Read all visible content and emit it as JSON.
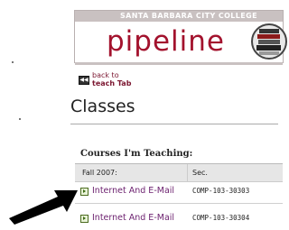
{
  "header": {
    "college": "SANTA BARBARA CITY COLLEGE",
    "brand": "pipeline",
    "colors": {
      "brand": "#a3122d",
      "banner_gray": "#c9c1c1",
      "link": "#6b1f6e"
    }
  },
  "back_link": {
    "line1": "back to",
    "line2": "teach Tab"
  },
  "page_title": "Classes",
  "section_title": "Courses I'm Teaching:",
  "table": {
    "headers": [
      "Fall 2007:",
      "Sec."
    ],
    "rows": [
      {
        "course": "Internet And E-Mail",
        "section": "COMP-103-30303"
      },
      {
        "course": "Internet And E-Mail",
        "section": "COMP-103-30304"
      }
    ]
  },
  "icons": [
    "back-arrow-icon",
    "logo-books-icon",
    "row-bullet-icon",
    "pointer-arrow-icon"
  ]
}
